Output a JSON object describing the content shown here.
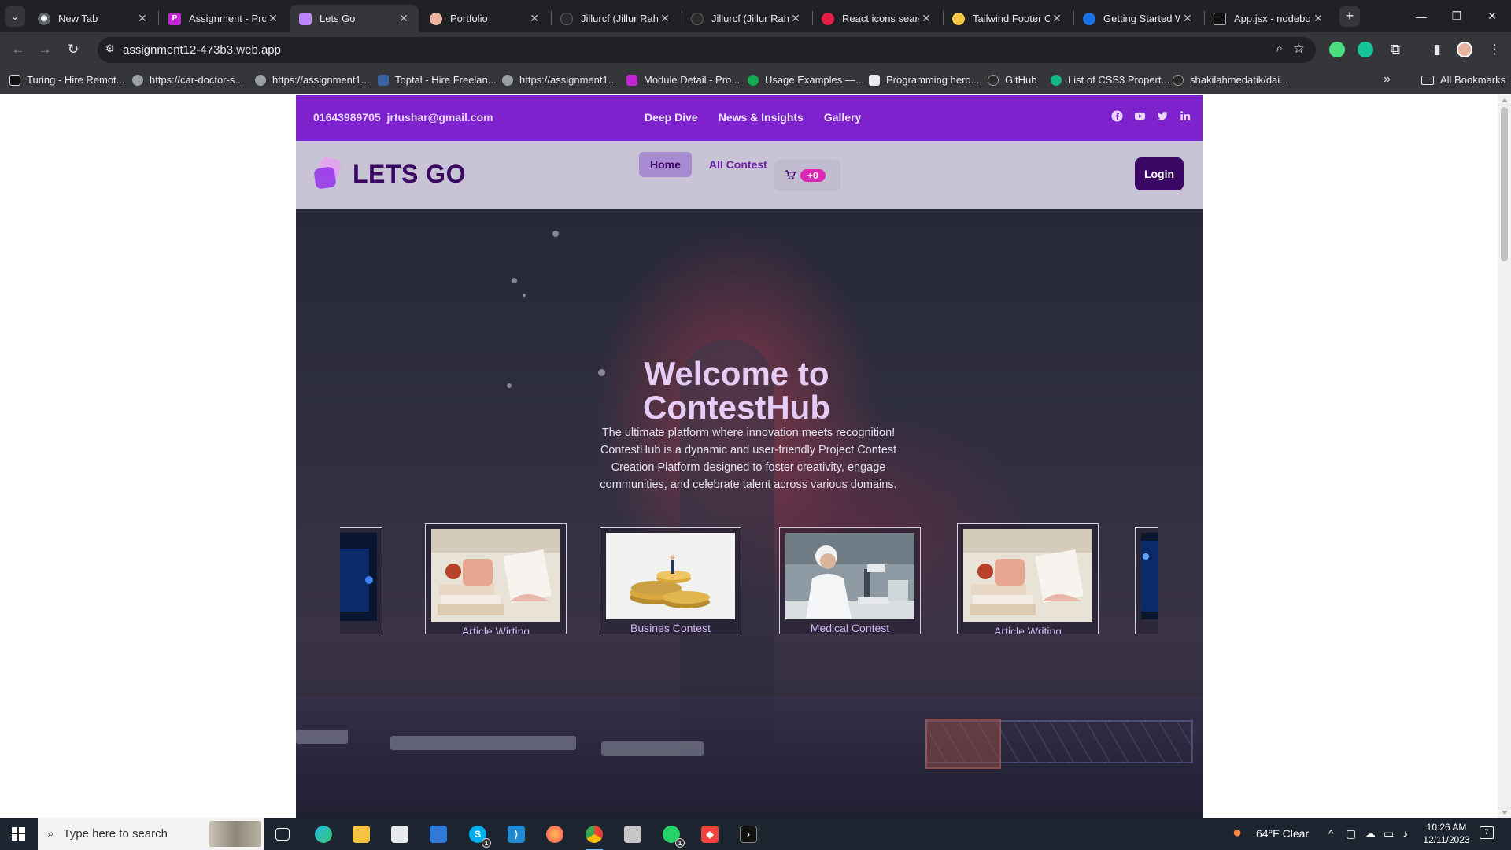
{
  "browser": {
    "tabs": [
      {
        "label": "New Tab",
        "icon": "chrome-icon",
        "color": "#9aa0a6"
      },
      {
        "label": "Assignment - Pro",
        "icon": "programming-hero-icon",
        "color": "#c026d3"
      },
      {
        "label": "Lets Go",
        "icon": "lets-go-icon",
        "color": "#c084fc"
      },
      {
        "label": "Portfolio",
        "icon": "portfolio-icon",
        "color": "#e8b4a0"
      },
      {
        "label": "Jillurcf (Jillur Rahm",
        "icon": "github-icon",
        "color": "#2b2b2b"
      },
      {
        "label": "Jillurcf (Jillur Rahm",
        "icon": "github-icon",
        "color": "#2b2b2b"
      },
      {
        "label": "React icons search",
        "icon": "react-icons-icon",
        "color": "#e11d48"
      },
      {
        "label": "Tailwind Footer Co",
        "icon": "tailwind-icon",
        "color": "#f5c542"
      },
      {
        "label": "Getting Started W",
        "icon": "getting-started-icon",
        "color": "#1a73e8"
      },
      {
        "label": "App.jsx - nodebo",
        "icon": "codesandbox-icon",
        "color": "#111111"
      }
    ],
    "url": "assignment12-473b3.web.app",
    "bookmarks": [
      {
        "label": "Turing - Hire Remot...",
        "color": "#111111"
      },
      {
        "label": "https://car-doctor-s...",
        "color": "#9aa0a6"
      },
      {
        "label": "https://assignment1...",
        "color": "#9aa0a6"
      },
      {
        "label": "Toptal - Hire Freelan...",
        "color": "#3863a0"
      },
      {
        "label": "https://assignment1...",
        "color": "#9aa0a6"
      },
      {
        "label": "Module Detail - Pro...",
        "color": "#c026d3"
      },
      {
        "label": "Usage Examples —...",
        "color": "#13aa52"
      },
      {
        "label": "Programming hero...",
        "color": "#e8eaed"
      },
      {
        "label": "GitHub",
        "color": "#2b2b2b"
      },
      {
        "label": "List of CSS3 Propert...",
        "color": "#10b981"
      },
      {
        "label": "shakilahmedatik/dai...",
        "color": "#2b2b2b"
      }
    ],
    "all_bookmarks": "All Bookmarks"
  },
  "site": {
    "topbar": {
      "phone": "01643989705",
      "email": "jrtushar@gmail.com",
      "links": [
        "Deep Dive",
        "News & Insights",
        "Gallery"
      ],
      "social_icons": [
        "facebook-icon",
        "youtube-icon",
        "twitter-icon",
        "linkedin-icon"
      ]
    },
    "navbar": {
      "logo_text": "LETS GO",
      "links": [
        "Home",
        "All Contest"
      ],
      "active_link": "Home",
      "cart_badge": "+0",
      "login_label": "Login"
    },
    "hero": {
      "title_line1": "Welcome to",
      "title_line2": "ContestHub",
      "description": "The ultimate platform where innovation meets recognition! ContestHub is a dynamic and user-friendly Project Contest Creation Platform designed to foster creativity, engage communities, and celebrate talent across various domains."
    },
    "carousel": [
      {
        "label": "",
        "image": "dark-partial-image"
      },
      {
        "label": "Article Wirting",
        "image": "books-coffee-image"
      },
      {
        "label": "Busines Contest",
        "image": "coins-image"
      },
      {
        "label": "Medical Contest",
        "image": "microscope-lab-image"
      },
      {
        "label": "Article Writing",
        "image": "books-coffee-image"
      },
      {
        "label": "",
        "image": "dark-partial-image"
      }
    ]
  },
  "taskbar": {
    "search_placeholder": "Type here to search",
    "weather": "64°F  Clear",
    "time": "10:26 AM",
    "date": "12/11/2023",
    "notifications": "7",
    "skype_badge": "1",
    "whatsapp_badge": "1"
  },
  "colors": {
    "topbar": "#7e22ce",
    "navbar": "#c8c4d6",
    "brand_dark": "#3b0764",
    "cart_badge": "#db27b4"
  }
}
